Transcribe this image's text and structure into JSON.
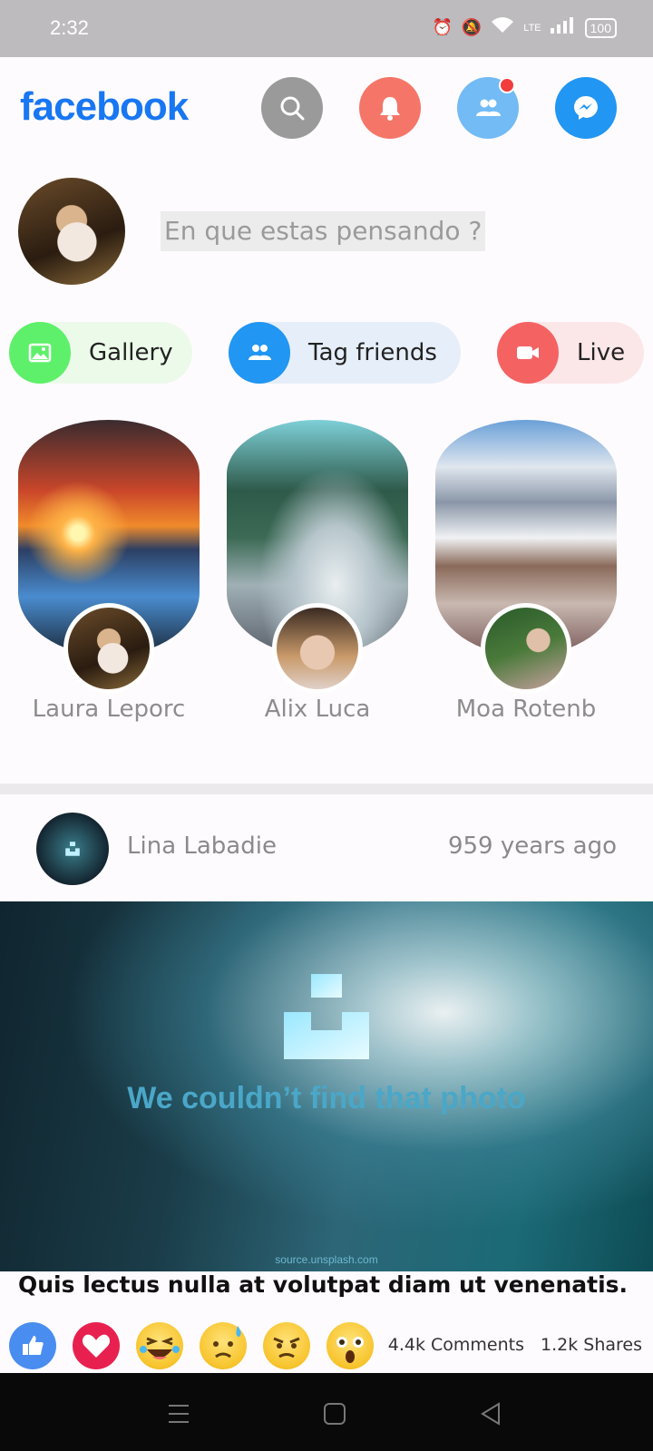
{
  "status_bar": {
    "time": "2:32",
    "battery": "100",
    "network": "LTE"
  },
  "header": {
    "logo": "facebook",
    "buttons": [
      {
        "name": "search-icon",
        "color": "#9a9a9a"
      },
      {
        "name": "bell-icon",
        "color": "#f57668"
      },
      {
        "name": "friends-icon",
        "color": "#72bbf5"
      },
      {
        "name": "messenger-icon",
        "color": "#2196f3"
      }
    ]
  },
  "composer": {
    "placeholder": "En que estas pensando ?"
  },
  "actions": {
    "gallery": {
      "label": "Gallery",
      "color": "#5ef06a",
      "bg": "#ecfaea"
    },
    "tag_friends": {
      "label": "Tag friends",
      "color": "#2196f3",
      "bg": "#e6eef9"
    },
    "live": {
      "label": "Live",
      "color": "#f56262",
      "bg": "#fbe6e8"
    }
  },
  "stories": [
    {
      "name": "Laura Leporc"
    },
    {
      "name": "Alix Luca"
    },
    {
      "name": "Moa Rotenb"
    }
  ],
  "post": {
    "author": "Lina Labadie",
    "time": "959 years ago",
    "image_message": "We couldn’t find that photo",
    "image_source": "source.unsplash.com",
    "caption": "Quis lectus nulla at volutpat diam ut venenatis.",
    "comments": "4.4k Comments",
    "shares": "1.2k Shares",
    "reactions": [
      "like-icon",
      "love-icon",
      "haha-icon",
      "sad-icon",
      "angry-icon",
      "wow-icon"
    ]
  }
}
